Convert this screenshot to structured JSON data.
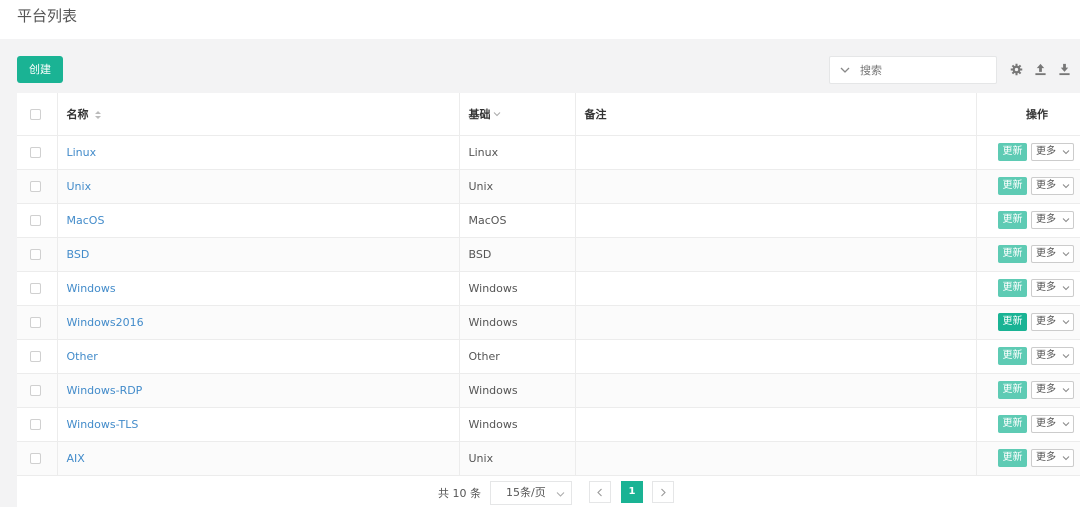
{
  "page": {
    "title": "平台列表"
  },
  "toolbar": {
    "create_label": "创建",
    "search_placeholder": "搜索",
    "icons": [
      "gear-icon",
      "upload-icon",
      "download-icon"
    ]
  },
  "table": {
    "headers": {
      "name": "名称",
      "base": "基础",
      "comment": "备注",
      "action": "操作"
    },
    "rows": [
      {
        "name": "Linux",
        "base": "Linux",
        "comment": ""
      },
      {
        "name": "Unix",
        "base": "Unix",
        "comment": ""
      },
      {
        "name": "MacOS",
        "base": "MacOS",
        "comment": ""
      },
      {
        "name": "BSD",
        "base": "BSD",
        "comment": ""
      },
      {
        "name": "Windows",
        "base": "Windows",
        "comment": ""
      },
      {
        "name": "Windows2016",
        "base": "Windows",
        "comment": ""
      },
      {
        "name": "Other",
        "base": "Other",
        "comment": ""
      },
      {
        "name": "Windows-RDP",
        "base": "Windows",
        "comment": ""
      },
      {
        "name": "Windows-TLS",
        "base": "Windows",
        "comment": ""
      },
      {
        "name": "AIX",
        "base": "Unix",
        "comment": ""
      }
    ],
    "update_label": "更新",
    "more_label": "更多"
  },
  "pagination": {
    "total_label": "共 10 条",
    "page_size_label": "15条/页",
    "current_page": "1"
  },
  "colors": {
    "accent": "#1ab394",
    "accent_light": "#5ecbb4",
    "link": "#428bca"
  }
}
